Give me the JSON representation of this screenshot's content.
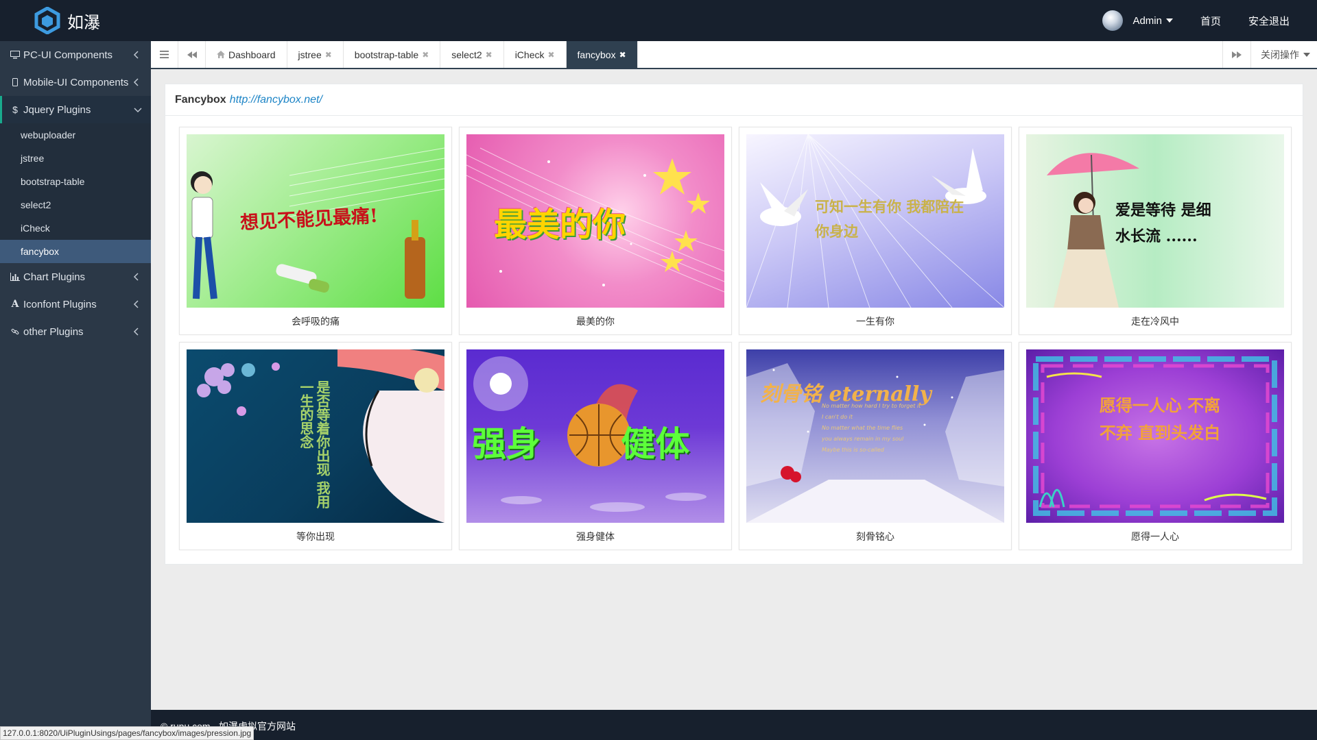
{
  "brand": {
    "name": "如瀑",
    "accent": "#2f8cd8"
  },
  "header": {
    "user": "Admin",
    "home": "首页",
    "logout": "安全退出"
  },
  "sidebar": {
    "groups": [
      {
        "label": "PC-UI Components",
        "icon": "desktop-icon"
      },
      {
        "label": "Mobile-UI Components",
        "icon": "mobile-icon"
      },
      {
        "label": "Jquery Plugins",
        "icon": "dollar-icon",
        "open": true
      },
      {
        "label": "Chart Plugins",
        "icon": "bar-chart-icon"
      },
      {
        "label": "Iconfont Plugins",
        "icon": "font-icon"
      },
      {
        "label": "other Plugins",
        "icon": "link-icon"
      }
    ],
    "items": [
      "webuploader",
      "jstree",
      "bootstrap-table",
      "select2",
      "iCheck",
      "fancybox"
    ],
    "active_item": "fancybox"
  },
  "tabs": {
    "items": [
      "Dashboard",
      "jstree",
      "bootstrap-table",
      "select2",
      "iCheck",
      "fancybox"
    ],
    "active": "fancybox",
    "close_ops": "关闭操作"
  },
  "panel": {
    "title": "Fancybox",
    "link": "http://fancybox.net/",
    "cards": [
      {
        "caption": "会呼吸的痛",
        "art_text": "想见不能见最痛!"
      },
      {
        "caption": "最美的你",
        "art_text": "最美的你"
      },
      {
        "caption": "一生有你",
        "art_text": "可知一生有你 我都陪在你身边"
      },
      {
        "caption": "走在冷风中",
        "art_text": "爱是等待 是细水长流 ......"
      },
      {
        "caption": "等你出现",
        "art_text": "是否等着你出现 我用一生的思念"
      },
      {
        "caption": "强身健体",
        "art_text": "强身 健体"
      },
      {
        "caption": "刻骨铭心",
        "art_text": "刻骨铭 eternally"
      },
      {
        "caption": "愿得一人心",
        "art_text": "愿得一人心 不离不弃 直到头发白"
      }
    ]
  },
  "footer": {
    "text": "© rupu.com - 如瀑虚拟官方网站"
  },
  "statusbar": {
    "url": "127.0.0.1:8020/UiPluginUsings/pages/fancybox/images/pression.jpg"
  }
}
